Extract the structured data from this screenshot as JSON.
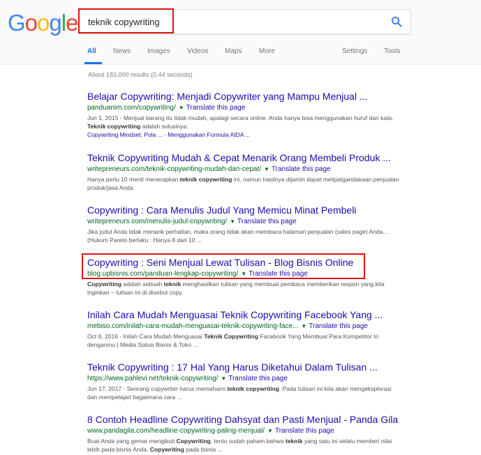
{
  "logo": {
    "letters": [
      "G",
      "o",
      "o",
      "g",
      "l",
      "e"
    ],
    "colors": [
      "#4285F4",
      "#EA4335",
      "#FBBC05",
      "#4285F4",
      "#34A853",
      "#EA4335"
    ]
  },
  "search": {
    "query": "teknik copywriting"
  },
  "tabs": [
    "All",
    "News",
    "Images",
    "Videos",
    "Maps",
    "More"
  ],
  "settings": "Settings",
  "tools": "Tools",
  "stats": "About 183,000 results (0.44 seconds)",
  "translate_label": "Translate this page",
  "accent": "#1a73e8",
  "highlight_color": "#e01010",
  "results": [
    {
      "title": "Belajar Copywriting: Menjadi Copywriter yang Mampu Menjual ...",
      "url": "panduanim.com/copywriting/",
      "snippet_parts": [
        {
          "t": "Jun 1, 2015 - Menjual barang itu tidak mudah, apalagi secara online. Anda hanya bisa menggunakan huruf dan kata. "
        },
        {
          "t": "Teknik copywriting",
          "b": true
        },
        {
          "t": " adalah solusinya."
        }
      ],
      "sitelinks": "Copywriting Mindset: Pola ... · Menggunakan Formula AIDA ..."
    },
    {
      "title": "Teknik Copywriting Mudah & Cepat Menarik Orang Membeli Produk ...",
      "url": "writepreneurs.com/teknik-copywriting-mudah-dan-cepat/",
      "snippet_parts": [
        {
          "t": "Hanya perlu 10 menit menerapkan "
        },
        {
          "t": "teknik copywriting",
          "b": true
        },
        {
          "t": " ini, namun hasilnya dijamin dapat melipatgandakaan penjualan produk/jasa Anda."
        }
      ]
    },
    {
      "title": "Copywriting : Cara Menulis Judul Yang Memicu Minat Pembeli",
      "url": "writepreneurs.com/menulis-judul-copywriting/",
      "snippet_parts": [
        {
          "t": "Jika judul Anda tidak menarik perhatian, maka orang tidak akan membaca halaman penjualan (sales page) Anda... (Hukum Pareto berlaku : Hanya 8 dari 10 ..."
        }
      ]
    },
    {
      "title": "Copywriting : Seni Menjual Lewat Tulisan - Blog Bisnis Online",
      "url": "blog.upbisnis.com/panduan-lengkap-copywriting/",
      "snippet_parts": [
        {
          "t": "Copywriting",
          "b": true
        },
        {
          "t": " adalah sebuah "
        },
        {
          "t": "teknik",
          "b": true
        },
        {
          "t": " menghasilkan tulisan yang membuat pembaca memberikan respon yang kita inginkan – tulisan ini di disebut copy."
        }
      ]
    },
    {
      "title": "Inilah Cara Mudah Menguasai Teknik Copywriting Facebook Yang ...",
      "url": "mebiso.com/inilah-cara-mudah-menguasai-teknik-copywriting-face...",
      "snippet_parts": [
        {
          "t": "Oct 6, 2016 - Inilah Cara Mudah Menguasai "
        },
        {
          "t": "Teknik Copywriting",
          "b": true
        },
        {
          "t": " Facebook Yang Membuat Para Kompetitor Iri denganmu | Media Solusi Bisnis & Toko ..."
        }
      ]
    },
    {
      "title": "Teknik Copywriting : 17 Hal Yang Harus Diketahui Dalam Tulisan ...",
      "url": "https://www.pahlevi.net/teknik-copywriting/",
      "snippet_parts": [
        {
          "t": "Jun 17, 2017 - Seorang copywriter harus memahami "
        },
        {
          "t": "teknik copywriting",
          "b": true
        },
        {
          "t": ". Pada tulisan ini kita akan mengeksplorasi dan mempelajari bagaimana cara ..."
        }
      ]
    },
    {
      "title": "8 Contoh Headline Copywriting Dahsyat dan Pasti Menjual - Panda Gila",
      "url": "www.pandagila.com/headline-copywriting-paling-menjual/",
      "snippet_parts": [
        {
          "t": "Buat Anda yang gemar mengikuti "
        },
        {
          "t": "Copywriting",
          "b": true
        },
        {
          "t": ", tentu sudah paham bahwa "
        },
        {
          "t": "teknik",
          "b": true
        },
        {
          "t": " yang satu ini selalu memberi nilai lebih pada bisnis Anda. "
        },
        {
          "t": "Copywriting",
          "b": true
        },
        {
          "t": " pada bisnis ..."
        }
      ]
    }
  ]
}
